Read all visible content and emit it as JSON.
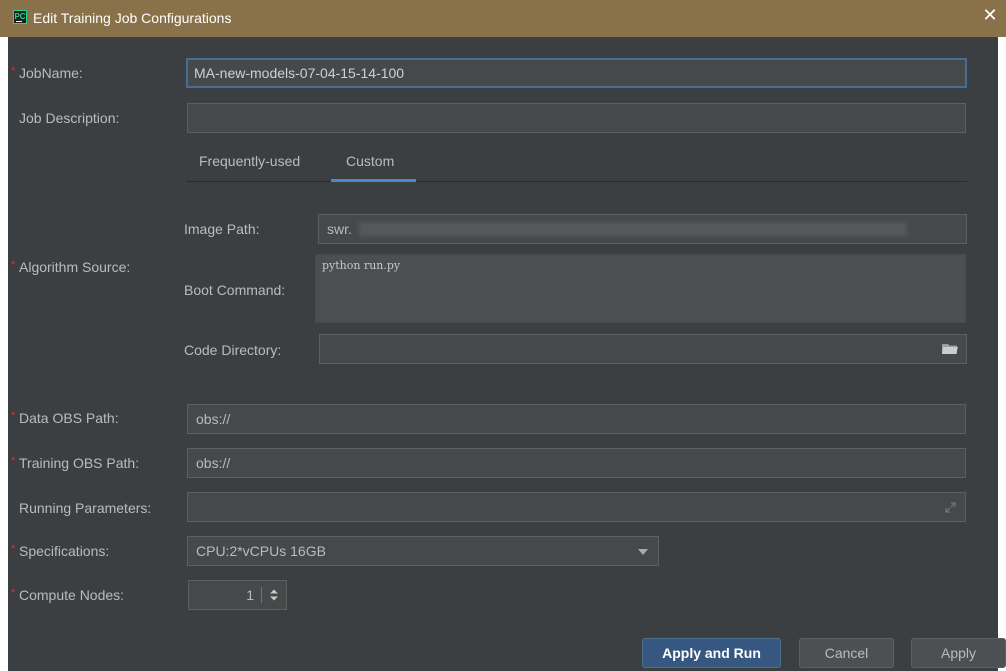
{
  "window": {
    "title": "Edit Training Job Configurations",
    "app_icon": "PC",
    "close_icon": "✕"
  },
  "form": {
    "required_marker": "*",
    "job_name_label": "JobName:",
    "job_name_value": "MA-new-models-07-04-15-14-100",
    "job_description_label": "Job Description:",
    "job_description_value": "",
    "tabs": [
      {
        "label": "Frequently-used",
        "active": false
      },
      {
        "label": "Custom",
        "active": true
      }
    ],
    "algorithm_source_label": "Algorithm Source:",
    "image_path_label": "Image Path:",
    "image_path_value": "swr.",
    "boot_command_label": "Boot Command:",
    "boot_command_value": "python run.py",
    "code_directory_label": "Code Directory:",
    "code_directory_value": "",
    "data_obs_label": "Data OBS Path:",
    "data_obs_value": "obs://",
    "training_obs_label": "Training OBS Path:",
    "training_obs_value": "obs://",
    "running_params_label": "Running Parameters:",
    "running_params_value": "",
    "specifications_label": "Specifications:",
    "specifications_value": "CPU:2*vCPUs 16GB",
    "compute_nodes_label": "Compute Nodes:",
    "compute_nodes_value": "1"
  },
  "buttons": {
    "apply_and_run": "Apply and Run",
    "cancel": "Cancel",
    "apply": "Apply"
  },
  "colors": {
    "title_bar": "#897149",
    "background": "#3c3f41",
    "required": "#d43434",
    "focus": "#466d94",
    "primary_button": "#365880"
  }
}
